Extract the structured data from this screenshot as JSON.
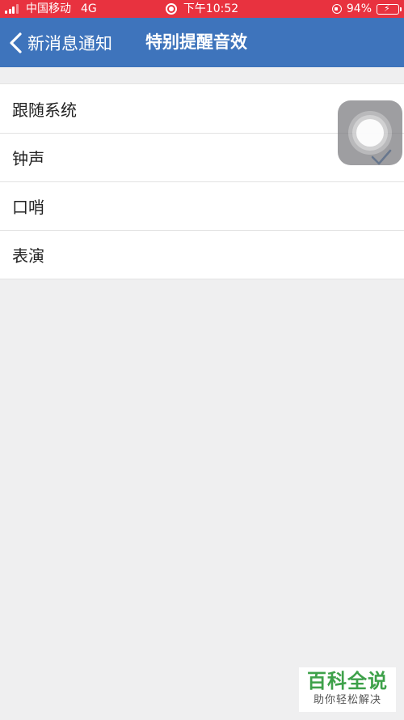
{
  "status_bar": {
    "carrier": "中国移动",
    "network": "4G",
    "time": "下午10:52",
    "battery_percent": "94%",
    "battery_level": 0.94,
    "icons": [
      "signal-icon",
      "screen-record-icon",
      "orientation-lock-icon",
      "battery-charging-icon"
    ]
  },
  "nav": {
    "back_label": "新消息通知",
    "title": "特别提醒音效"
  },
  "sound_options": [
    {
      "label": "跟随系统",
      "selected": false
    },
    {
      "label": "钟声",
      "selected": true
    },
    {
      "label": "口哨",
      "selected": false
    },
    {
      "label": "表演",
      "selected": false
    }
  ],
  "watermark": {
    "title": "百科全说",
    "subtitle": "助你轻松解决"
  },
  "colors": {
    "status_bar": "#e8323f",
    "nav_bar": "#3e74bc",
    "checkmark": "#3e74bc",
    "background": "#efeff0",
    "watermark_green": "#3ea14a"
  }
}
